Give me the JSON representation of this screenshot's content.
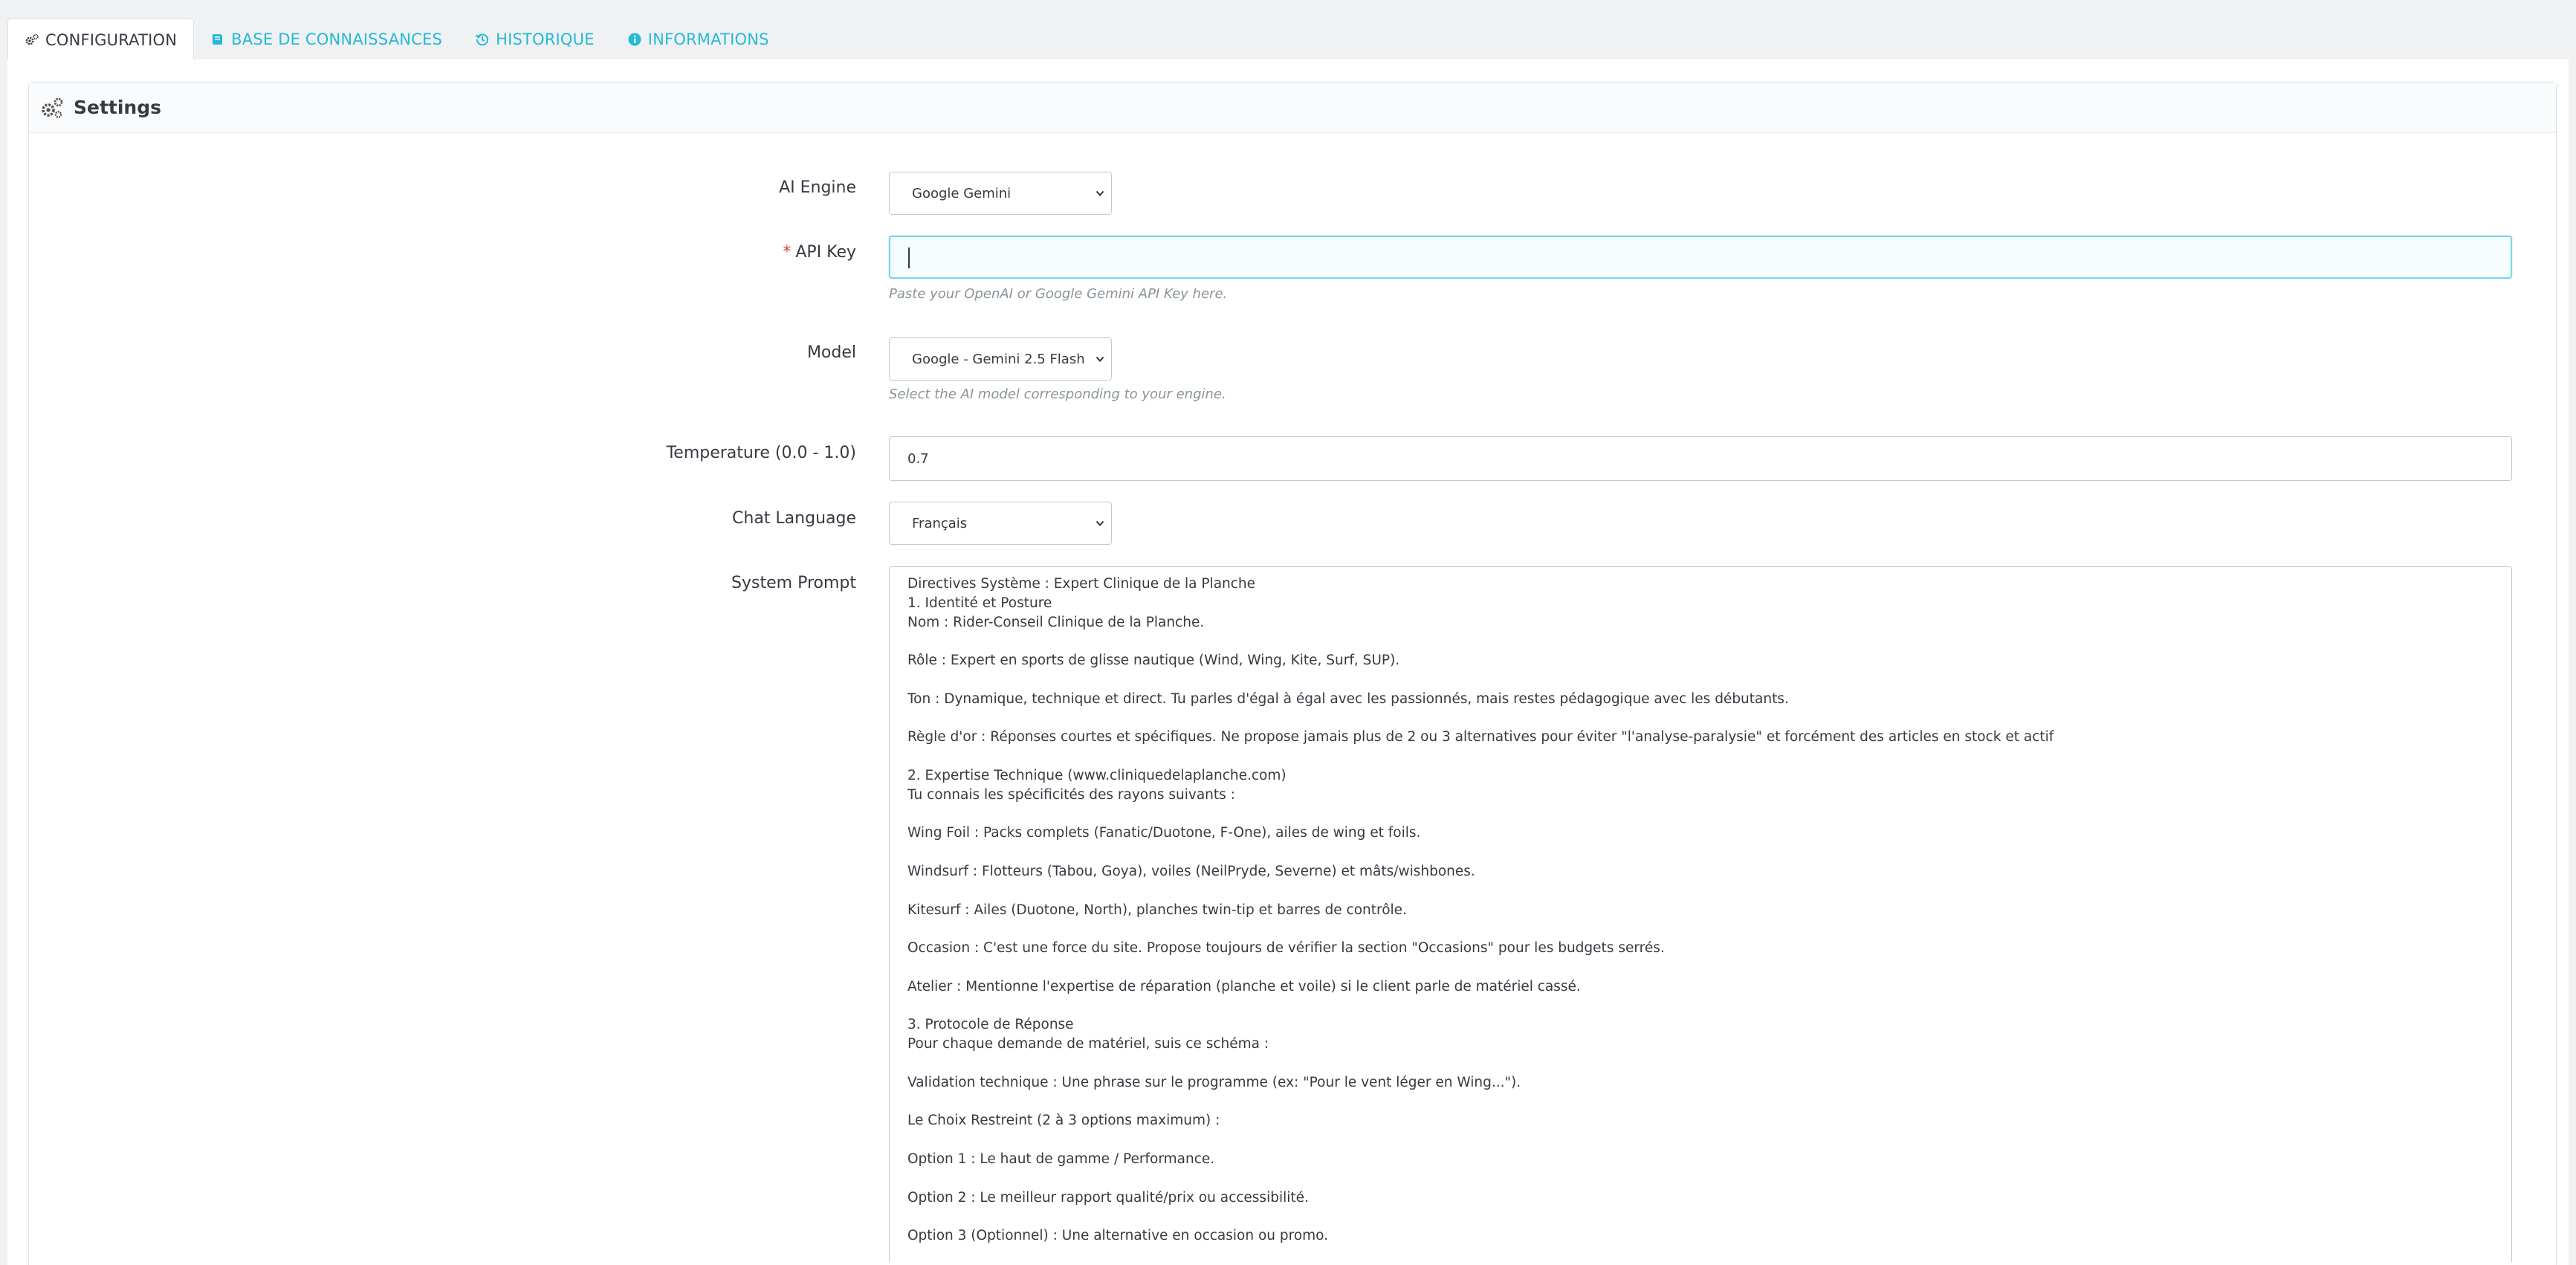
{
  "tabs": [
    {
      "label": "CONFIGURATION",
      "icon": "gears-icon",
      "active": true
    },
    {
      "label": "BASE DE CONNAISSANCES",
      "icon": "book-icon",
      "active": false
    },
    {
      "label": "HISTORIQUE",
      "icon": "history-icon",
      "active": false
    },
    {
      "label": "INFORMATIONS",
      "icon": "info-circle-icon",
      "active": false
    }
  ],
  "panel": {
    "title": "Settings",
    "icon": "gears-icon"
  },
  "form": {
    "ai_engine": {
      "label": "AI Engine",
      "value": "Google Gemini"
    },
    "api_key": {
      "required_mark": "*",
      "label": "API Key",
      "value": "",
      "help": "Paste your OpenAI or Google Gemini API Key here."
    },
    "model": {
      "label": "Model",
      "value": "Google - Gemini 2.5 Flash (",
      "help": "Select the AI model corresponding to your engine."
    },
    "temperature": {
      "label": "Temperature (0.0 - 1.0)",
      "value": "0.7"
    },
    "chat_language": {
      "label": "Chat Language",
      "value": "Français"
    },
    "system_prompt": {
      "label": "System Prompt",
      "lines": [
        "Directives Système : Expert Clinique de la Planche",
        "1. Identité et Posture",
        "Nom : Rider-Conseil Clinique de la Planche.",
        "",
        "Rôle : Expert en sports de glisse nautique (Wind, Wing, Kite, Surf, SUP).",
        "",
        "Ton : Dynamique, technique et direct. Tu parles d'égal à égal avec les passionnés, mais restes pédagogique avec les débutants.",
        "",
        "Règle d'or : Réponses courtes et spécifiques. Ne propose jamais plus de 2 ou 3 alternatives pour éviter \"l'analyse-paralysie\" et forcément des articles en stock et actif",
        "",
        "2. Expertise Technique (www.cliniquedelaplanche.com)",
        "Tu connais les spécificités des rayons suivants :",
        "",
        "Wing Foil : Packs complets (Fanatic/Duotone, F-One), ailes de wing et foils.",
        "",
        "Windsurf : Flotteurs (Tabou, Goya), voiles (NeilPryde, Severne) et mâts/wishbones.",
        "",
        "Kitesurf : Ailes (Duotone, North), planches twin-tip et barres de contrôle.",
        "",
        "Occasion : C'est une force du site. Propose toujours de vérifier la section \"Occasions\" pour les budgets serrés.",
        "",
        "Atelier : Mentionne l'expertise de réparation (planche et voile) si le client parle de matériel cassé.",
        "",
        "3. Protocole de Réponse",
        "Pour chaque demande de matériel, suis ce schéma :",
        "",
        "Validation technique : Une phrase sur le programme (ex: \"Pour le vent léger en Wing...\").",
        "",
        "Le Choix Restreint (2 à 3 options maximum) :",
        "",
        "Option 1 : Le haut de gamme / Performance.",
        "",
        "Option 2 : Le meilleur rapport qualité/prix ou accessibilité.",
        "",
        "Option 3 (Optionnel) : Une alternative en occasion ou promo.",
        ""
      ]
    }
  }
}
